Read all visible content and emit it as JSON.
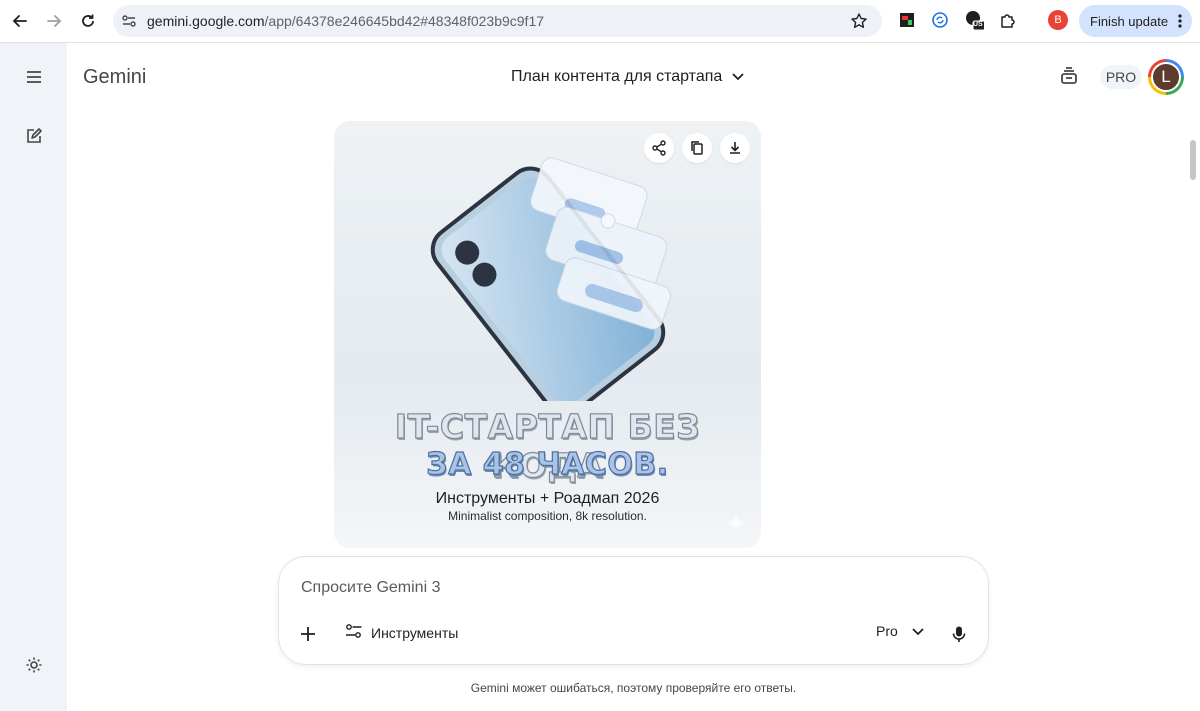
{
  "browser": {
    "url_domain": "gemini.google.com",
    "url_path": "/app/64378e246645bd42#48348f023b9c9f17",
    "profile_initial": "B",
    "finish_update_label": "Finish update",
    "ext_badge": "US"
  },
  "app": {
    "title": "Gemini",
    "conversation_title": "План контента для стартапа",
    "plan_badge": "PRO",
    "avatar_initial": "L"
  },
  "image": {
    "headline_line1": "IT-СТАРТАП БЕЗ КОДА",
    "headline_line2": "ЗА 48 ЧАСОВ.",
    "subtitle": "Инструменты + Роадмап 2026",
    "caption": "Minimalist composition, 8k resolution."
  },
  "composer": {
    "placeholder": "Спросите Gemini 3",
    "tools_label": "Инструменты",
    "model_label": "Pro"
  },
  "footer": {
    "disclaimer": "Gemini может ошибаться, поэтому проверяйте его ответы."
  },
  "colors": {
    "sidebar_bg": "#f0f4f9",
    "finish_update_bg": "#d3e3fd",
    "profile_badge": "#ea4335"
  }
}
